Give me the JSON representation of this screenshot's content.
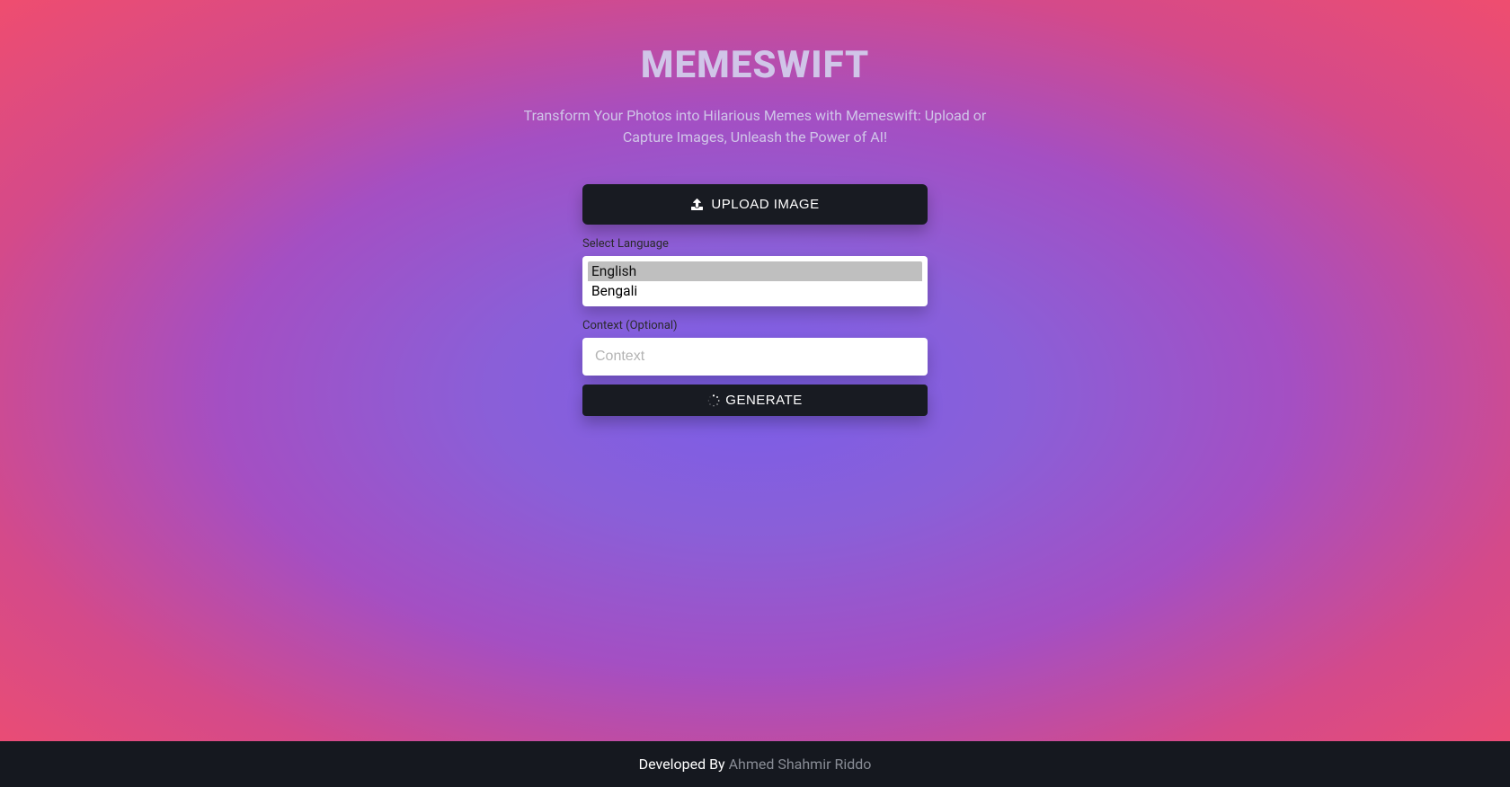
{
  "header": {
    "title": "MEMESWIFT",
    "subtitle": "Transform Your Photos into Hilarious Memes with Memeswift: Upload or Capture Images, Unleash the Power of AI!"
  },
  "form": {
    "upload_label": "UPLOAD IMAGE",
    "language_label": "Select Language",
    "language_options": [
      "English",
      "Bengali"
    ],
    "language_selected": "English",
    "context_label": "Context (Optional)",
    "context_placeholder": "Context",
    "context_value": "",
    "generate_label": "GENERATE"
  },
  "footer": {
    "prefix": "Developed By ",
    "author": "Ahmed Shahmir Riddo"
  }
}
